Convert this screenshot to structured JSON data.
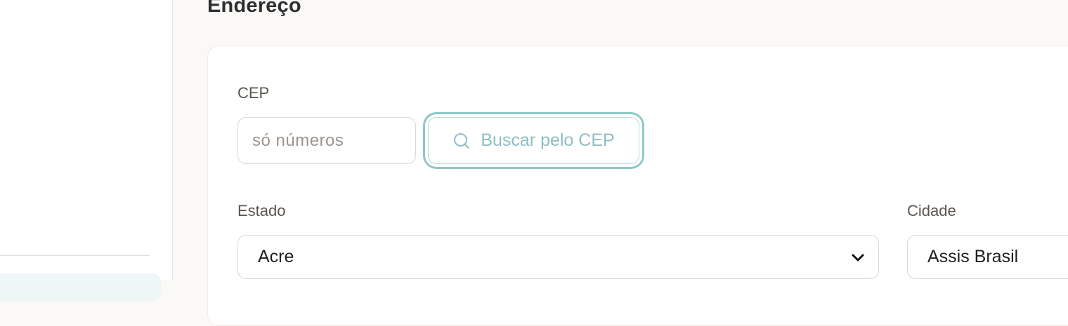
{
  "address": {
    "section_title": "Endereço",
    "cep": {
      "label": "CEP",
      "placeholder": "só números",
      "value": ""
    },
    "search_button": {
      "label": "Buscar pelo CEP",
      "icon": "search-icon"
    },
    "state": {
      "label": "Estado",
      "selected": "Acre"
    },
    "city": {
      "label": "Cidade",
      "selected": "Assis Brasil"
    }
  },
  "colors": {
    "accent": "#8ec7c9",
    "background": "#faf9f7",
    "card": "#ffffff"
  }
}
